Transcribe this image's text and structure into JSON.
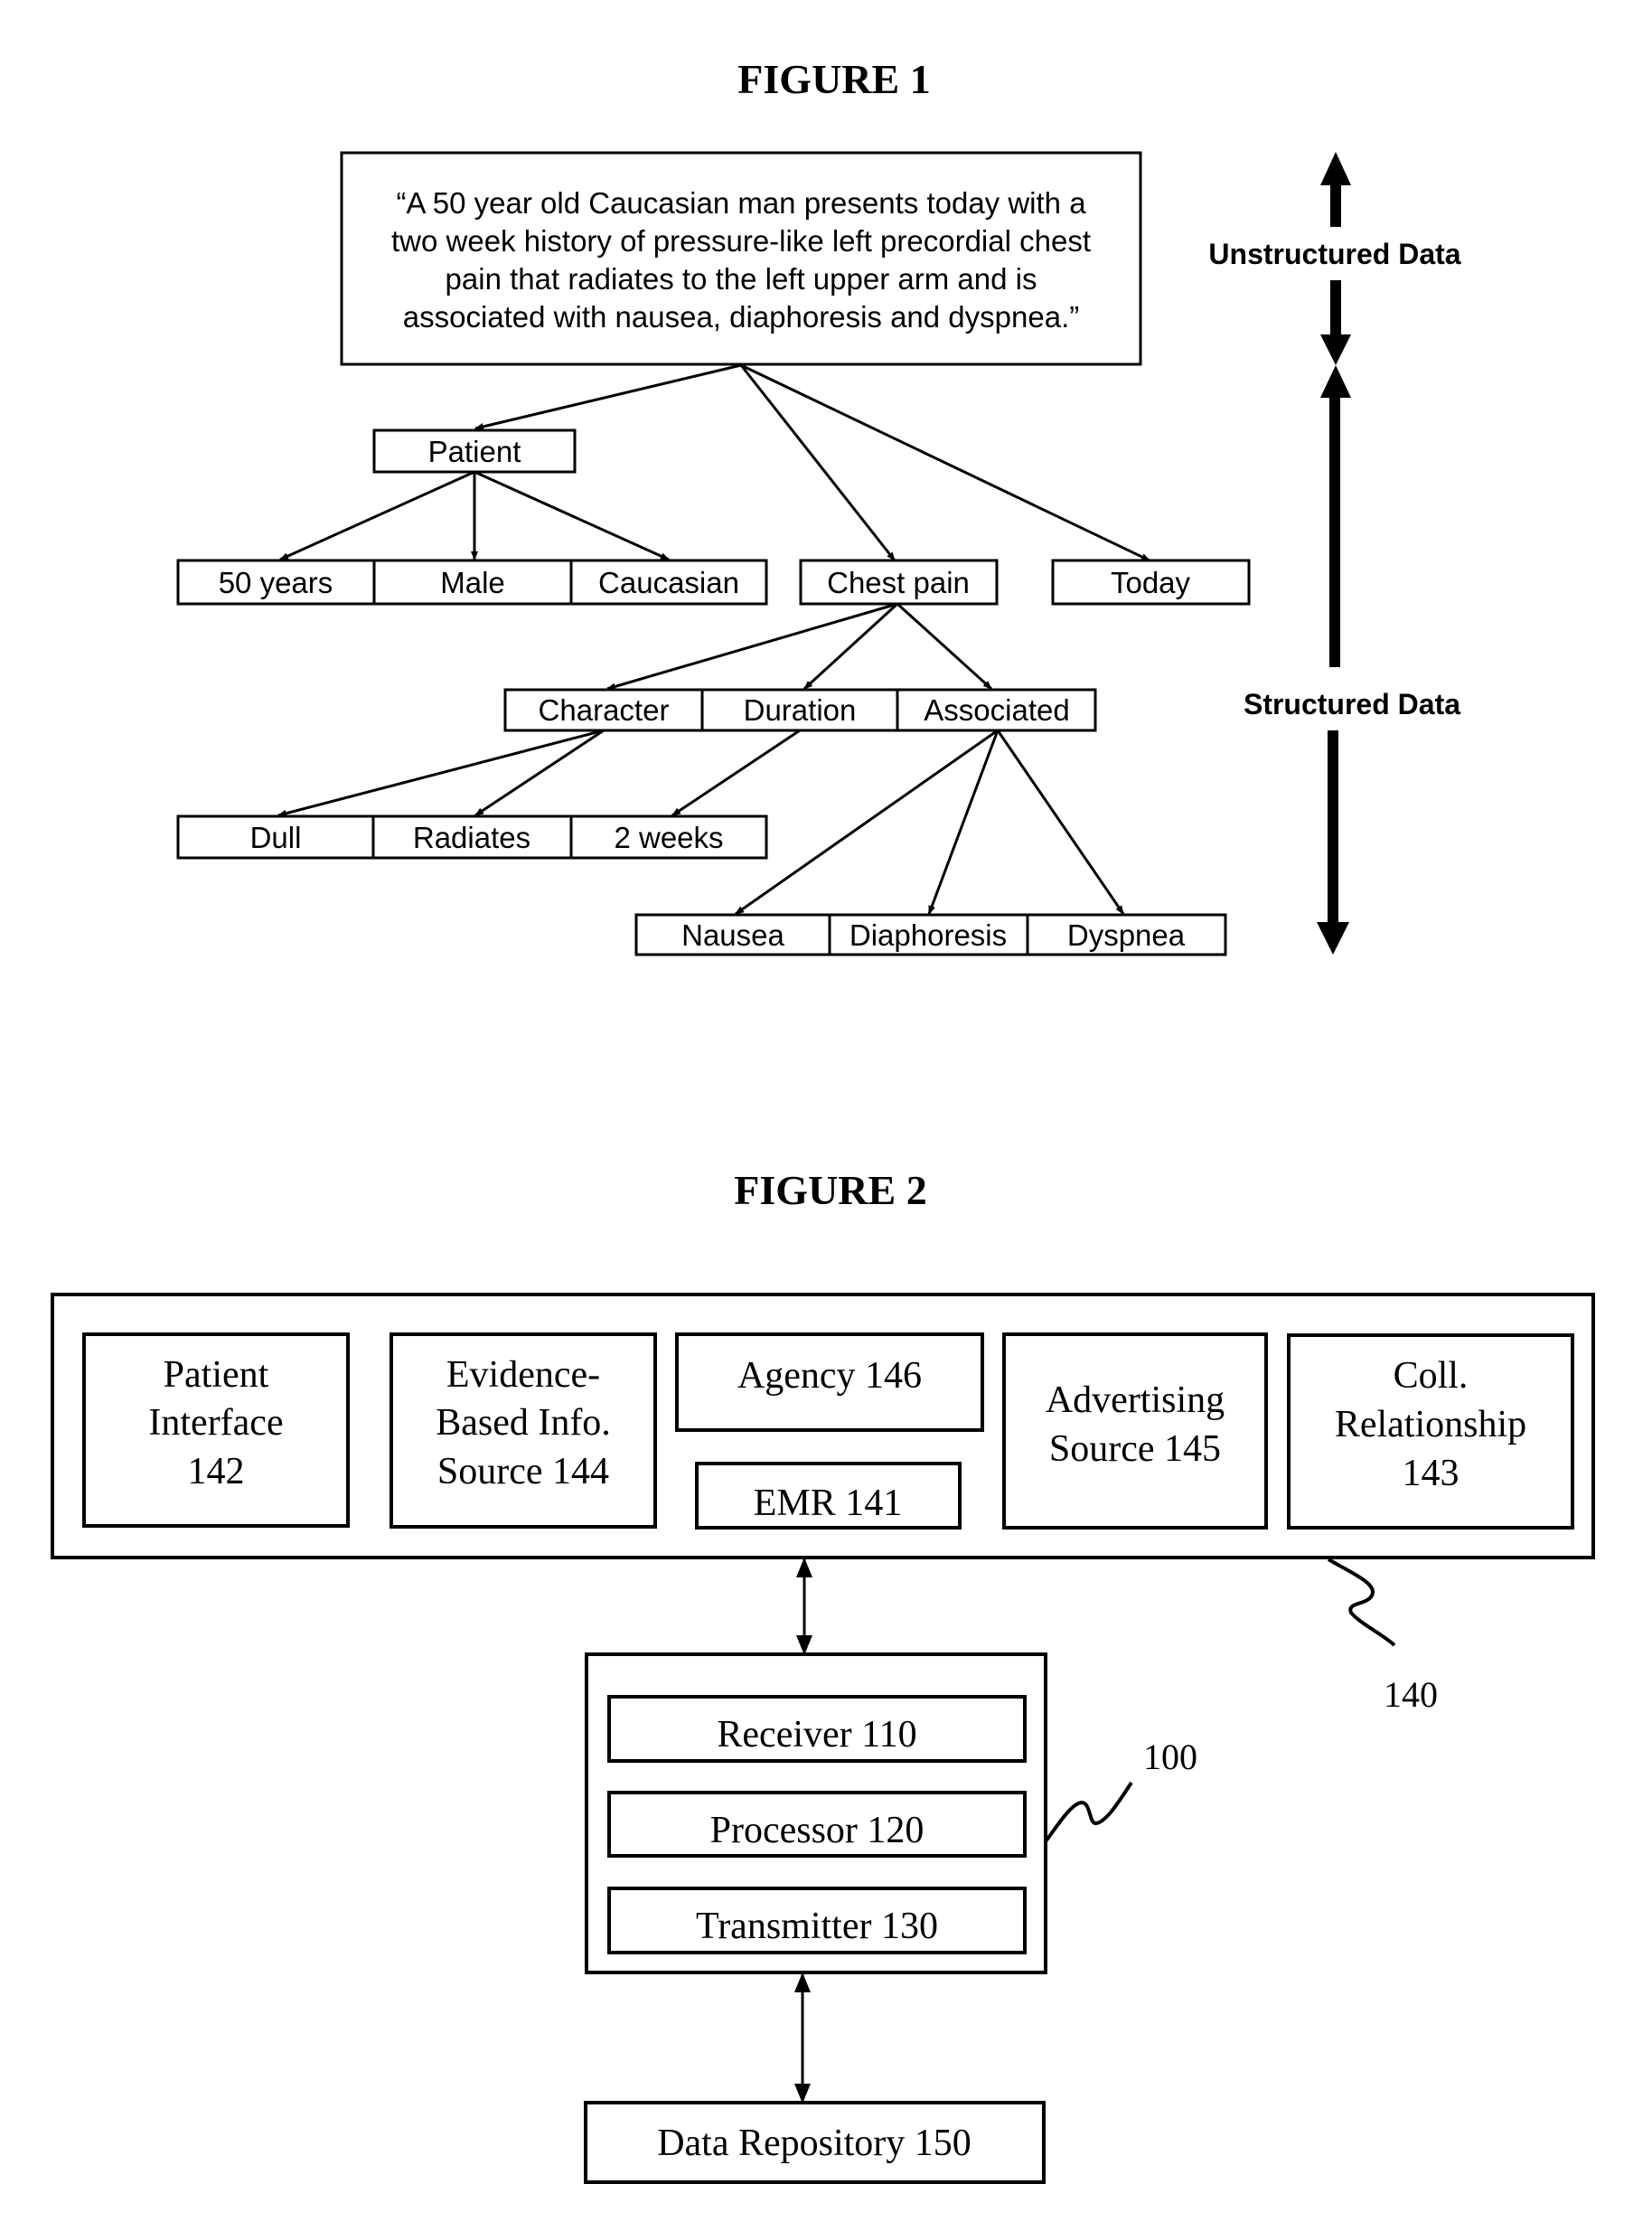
{
  "figure1": {
    "title": "FIGURE 1",
    "quote_lines": [
      "“A 50 year old Caucasian man presents today with a",
      "two week history of pressure-like left precordial chest",
      "pain that radiates to the left upper arm and is",
      "associated with nausea, diaphoresis and dyspnea.”"
    ],
    "nodes": {
      "patient": "Patient",
      "patient_attrs": [
        "50 years",
        "Male",
        "Caucasian"
      ],
      "chest_pain": "Chest pain",
      "today": "Today",
      "chest_pain_attrs": [
        "Character",
        "Duration",
        "Associated"
      ],
      "character_duration_values": [
        "Dull",
        "Radiates",
        "2 weeks"
      ],
      "associated_values": [
        "Nausea",
        "Diaphoresis",
        "Dyspnea"
      ]
    },
    "side_labels": {
      "unstructured": "Unstructured Data",
      "structured": "Structured Data"
    }
  },
  "figure2": {
    "title": "FIGURE 2",
    "system_ref": "140",
    "components": {
      "patient_interface": [
        "Patient",
        "Interface",
        "142"
      ],
      "evidence_source": [
        "Evidence-",
        "Based Info.",
        "Source 144"
      ],
      "agency": "Agency 146",
      "emr": "EMR 141",
      "advertising": [
        "Advertising",
        "Source 145"
      ],
      "collaborative": [
        "Coll.",
        "Relationship",
        "143"
      ]
    },
    "device_ref": "100",
    "device_components": [
      "Receiver 110",
      "Processor 120",
      "Transmitter 130"
    ],
    "repository": "Data Repository 150"
  }
}
